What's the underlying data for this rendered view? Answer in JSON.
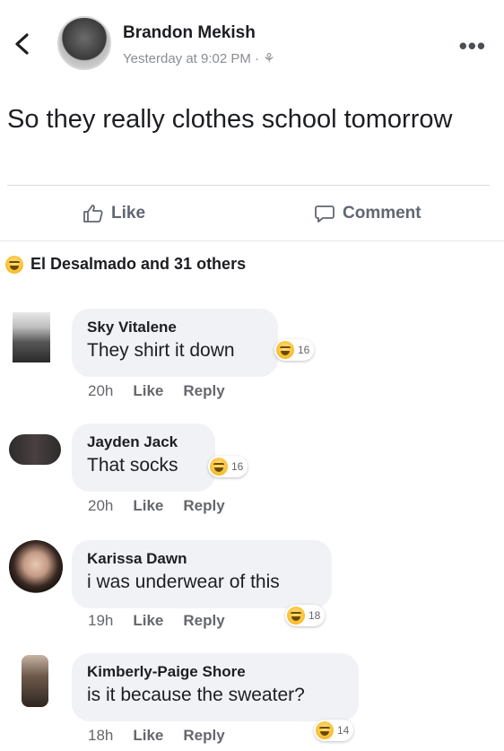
{
  "post": {
    "author": "Brandon Mekish",
    "meta": "Yesterday at 9:02 PM · ⚘",
    "text": "So they really clothes school tomorrow"
  },
  "actions": {
    "like_label": "Like",
    "comment_label": "Comment"
  },
  "reactions": {
    "summary": "El Desalmado and 31 others"
  },
  "comments": [
    {
      "name": "Sky Vitalene",
      "text": "They shirt it down",
      "time": "20h",
      "like": "Like",
      "reply": "Reply",
      "reactions": "16"
    },
    {
      "name": "Jayden Jack",
      "text": "That socks",
      "time": "20h",
      "like": "Like",
      "reply": "Reply",
      "reactions": "16"
    },
    {
      "name": "Karissa Dawn",
      "text": "i was underwear of this",
      "time": "19h",
      "like": "Like",
      "reply": "Reply",
      "reactions": "18"
    },
    {
      "name": "Kimberly-Paige Shore",
      "text": "is it because the sweater?",
      "time": "18h",
      "like": "Like",
      "reply": "Reply",
      "reactions": "14"
    }
  ],
  "colors": {
    "bubble": "#f0f2f5",
    "secondary_text": "#65676b",
    "reaction_yellow": "#f7b928"
  },
  "icons": [
    "back-arrow-icon",
    "more-options-icon",
    "thumbs-up-icon",
    "comment-bubble-icon",
    "haha-reaction-icon",
    "friends-audience-icon"
  ]
}
